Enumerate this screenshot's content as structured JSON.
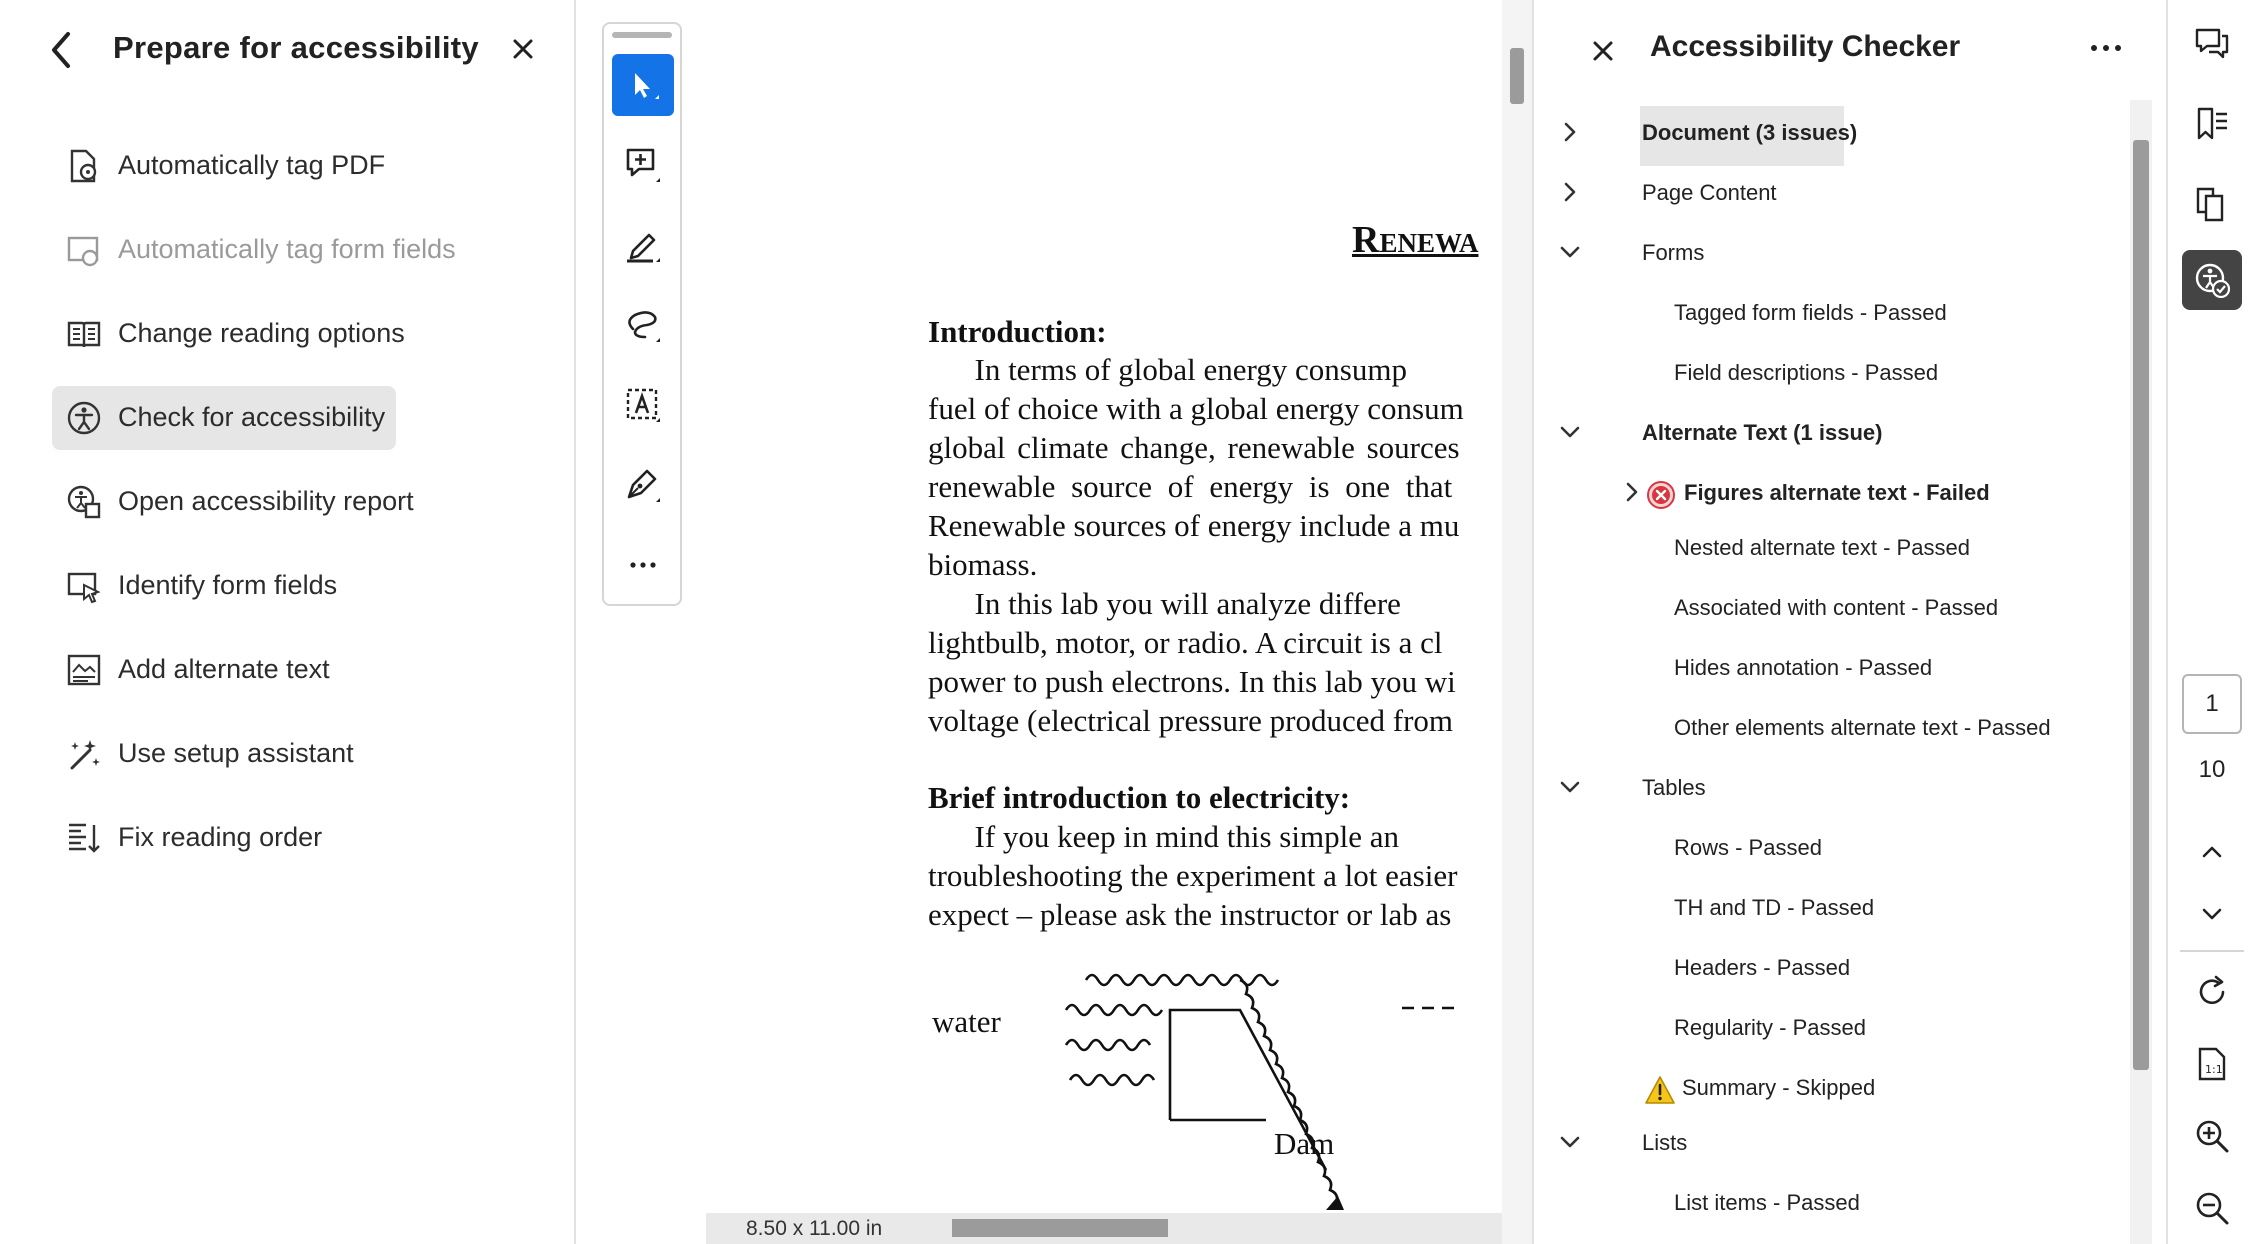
{
  "left_panel": {
    "title": "Prepare for accessibility",
    "items": [
      {
        "label": "Automatically tag PDF",
        "icon": "auto-tag-pdf-icon",
        "disabled": false
      },
      {
        "label": "Automatically tag form fields",
        "icon": "auto-tag-form-icon",
        "disabled": true
      },
      {
        "label": "Change reading options",
        "icon": "reading-options-icon",
        "disabled": false
      },
      {
        "label": "Check for accessibility",
        "icon": "accessibility-check-icon",
        "disabled": false,
        "active": true
      },
      {
        "label": "Open accessibility report",
        "icon": "accessibility-report-icon",
        "disabled": false
      },
      {
        "label": "Identify form fields",
        "icon": "identify-form-fields-icon",
        "disabled": false
      },
      {
        "label": "Add alternate text",
        "icon": "alternate-text-icon",
        "disabled": false
      },
      {
        "label": "Use setup assistant",
        "icon": "setup-assistant-icon",
        "disabled": false
      },
      {
        "label": "Fix reading order",
        "icon": "reading-order-icon",
        "disabled": false
      }
    ]
  },
  "toolbar": {
    "tools": [
      "select-tool-icon",
      "add-comment-icon",
      "highlight-pen-icon",
      "lasso-icon",
      "text-recognition-icon",
      "sign-icon",
      "more-tools-icon"
    ]
  },
  "document": {
    "title_fragment": "Renewa",
    "lines": [
      {
        "text": "Introduction:",
        "bold": true
      },
      {
        "text": "      In terms of global energy consump",
        "bold": false
      },
      {
        "text": "fuel of choice with a global energy consum",
        "bold": false
      },
      {
        "text": "global climate change, renewable sources",
        "bold": false
      },
      {
        "text": "renewable source of energy is one that",
        "bold": false
      },
      {
        "text": "Renewable sources of energy include a mu",
        "bold": false
      },
      {
        "text": "biomass.",
        "bold": false
      },
      {
        "text": "      In this lab you will analyze differe",
        "bold": false
      },
      {
        "text": "lightbulb, motor, or radio. A circuit is a cl",
        "bold": false
      },
      {
        "text": "power to push electrons. In this lab you wi",
        "bold": false
      },
      {
        "text": "voltage (electrical pressure produced from",
        "bold": false
      },
      {
        "text": "Brief introduction to electricity:",
        "bold": true
      },
      {
        "text": "      If you keep in mind this simple an",
        "bold": false
      },
      {
        "text": "troubleshooting the experiment a lot easier",
        "bold": false
      },
      {
        "text": "expect – please ask the instructor or lab as",
        "bold": false
      }
    ],
    "diagram": {
      "water_label": "water",
      "dam_label": "Dam"
    },
    "page_size": "8.50 x 11.00 in"
  },
  "checker": {
    "title": "Accessibility Checker",
    "rows": [
      {
        "text": "Document (3 issues)",
        "level": 0,
        "chevron": "right",
        "bold": true,
        "selected": true
      },
      {
        "text": "Page Content",
        "level": 0,
        "chevron": "right",
        "bold": false
      },
      {
        "text": "Forms",
        "level": 0,
        "chevron": "down",
        "bold": false
      },
      {
        "text": "Tagged form fields - Passed",
        "level": 1
      },
      {
        "text": "Field descriptions - Passed",
        "level": 1
      },
      {
        "text": "Alternate Text (1 issue)",
        "level": 0,
        "chevron": "down",
        "bold": true
      },
      {
        "text": "Figures alternate text - Failed",
        "level": 1,
        "chevron": "right",
        "bold": true,
        "status": "failed"
      },
      {
        "text": "Nested alternate text - Passed",
        "level": 1
      },
      {
        "text": "Associated with content - Passed",
        "level": 1
      },
      {
        "text": "Hides annotation - Passed",
        "level": 1
      },
      {
        "text": "Other elements alternate text - Passed",
        "level": 1
      },
      {
        "text": "Tables",
        "level": 0,
        "chevron": "down",
        "bold": false
      },
      {
        "text": "Rows - Passed",
        "level": 1
      },
      {
        "text": "TH and TD - Passed",
        "level": 1
      },
      {
        "text": "Headers - Passed",
        "level": 1
      },
      {
        "text": "Regularity - Passed",
        "level": 1
      },
      {
        "text": "Summary - Skipped",
        "level": 1,
        "status": "skipped"
      },
      {
        "text": "Lists",
        "level": 0,
        "chevron": "down",
        "bold": false
      },
      {
        "text": "List items - Passed",
        "level": 1
      }
    ]
  },
  "rail": {
    "current_page": "1",
    "total_pages": "10",
    "icons": [
      "comments-icon",
      "bookmarks-icon",
      "pages-icon",
      "accessibility-icon",
      "page-up-icon",
      "page-down-icon",
      "rotate-icon",
      "fit-page-icon",
      "zoom-in-icon",
      "zoom-out-icon"
    ]
  },
  "colors": {
    "accent": "#1473e6",
    "failed": "#d7373f",
    "warning": "#e6a800",
    "selected_bg": "#e6e6e6"
  }
}
